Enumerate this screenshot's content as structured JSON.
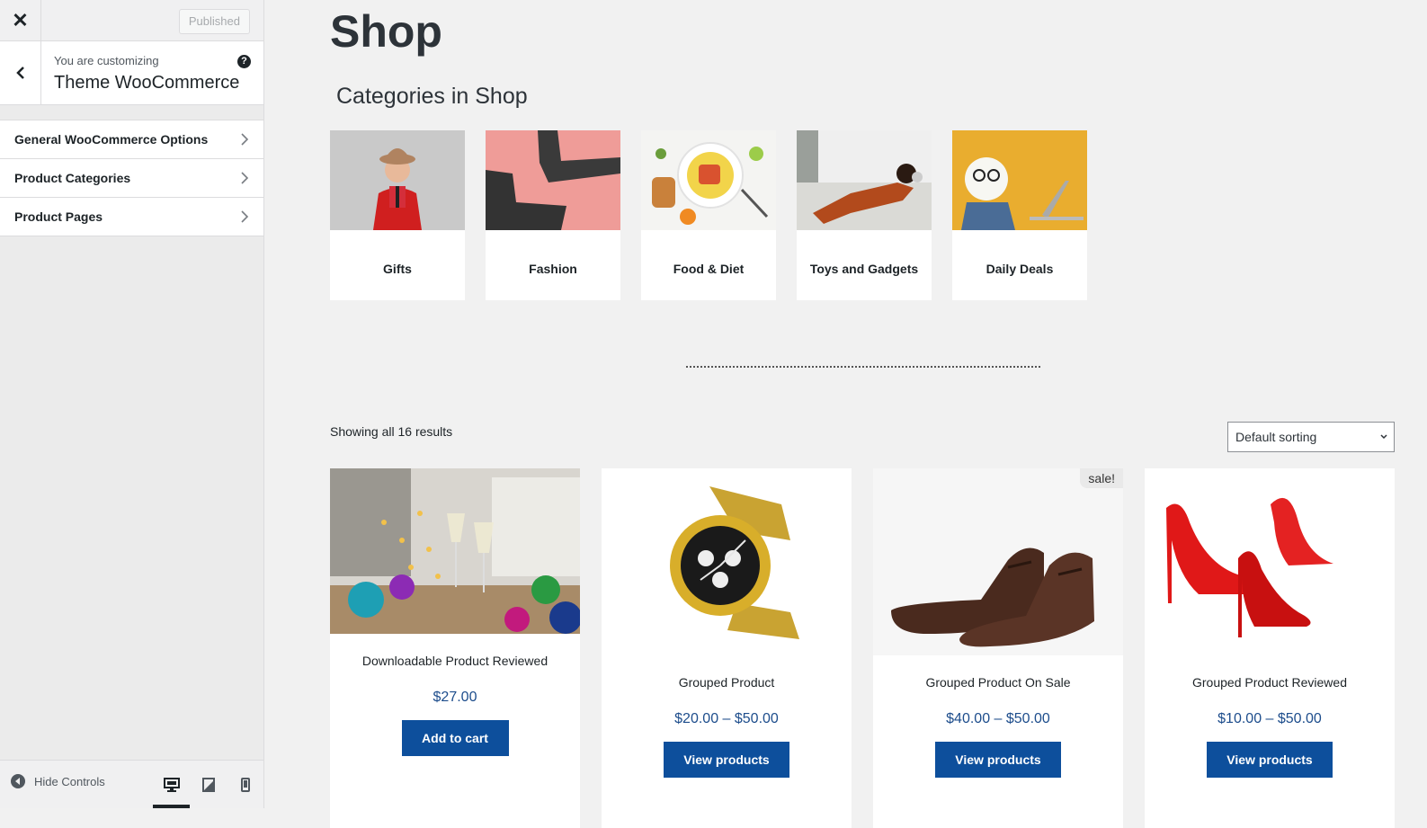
{
  "customizer": {
    "published_label": "Published",
    "customizing_label": "You are customizing",
    "theme_name": "Theme WooCommerce",
    "panels": [
      {
        "label": "General WooCommerce Options"
      },
      {
        "label": "Product Categories"
      },
      {
        "label": "Product Pages"
      }
    ],
    "hide_controls_label": "Hide Controls"
  },
  "shop": {
    "title": "Shop",
    "categories_heading": "Categories in Shop",
    "categories": [
      {
        "name": "Gifts"
      },
      {
        "name": "Fashion"
      },
      {
        "name": "Food & Diet"
      },
      {
        "name": "Toys and Gadgets"
      },
      {
        "name": "Daily Deals"
      }
    ],
    "result_count": "Showing all 16 results",
    "sorting_value": "Default sorting",
    "products": [
      {
        "name": "Downloadable Product Reviewed",
        "price": "$27.00",
        "button": "Add to cart"
      },
      {
        "name": "Grouped Product",
        "price": "$20.00 – $50.00",
        "button": "View products"
      },
      {
        "name": "Grouped Product On Sale",
        "price": "$40.00 – $50.00",
        "button": "View products",
        "badge": "sale!"
      },
      {
        "name": "Grouped Product Reviewed",
        "price": "$10.00 – $50.00",
        "button": "View products"
      }
    ]
  },
  "colors": {
    "button_blue": "#0d4f9c",
    "price_blue": "#1d4d8c"
  }
}
